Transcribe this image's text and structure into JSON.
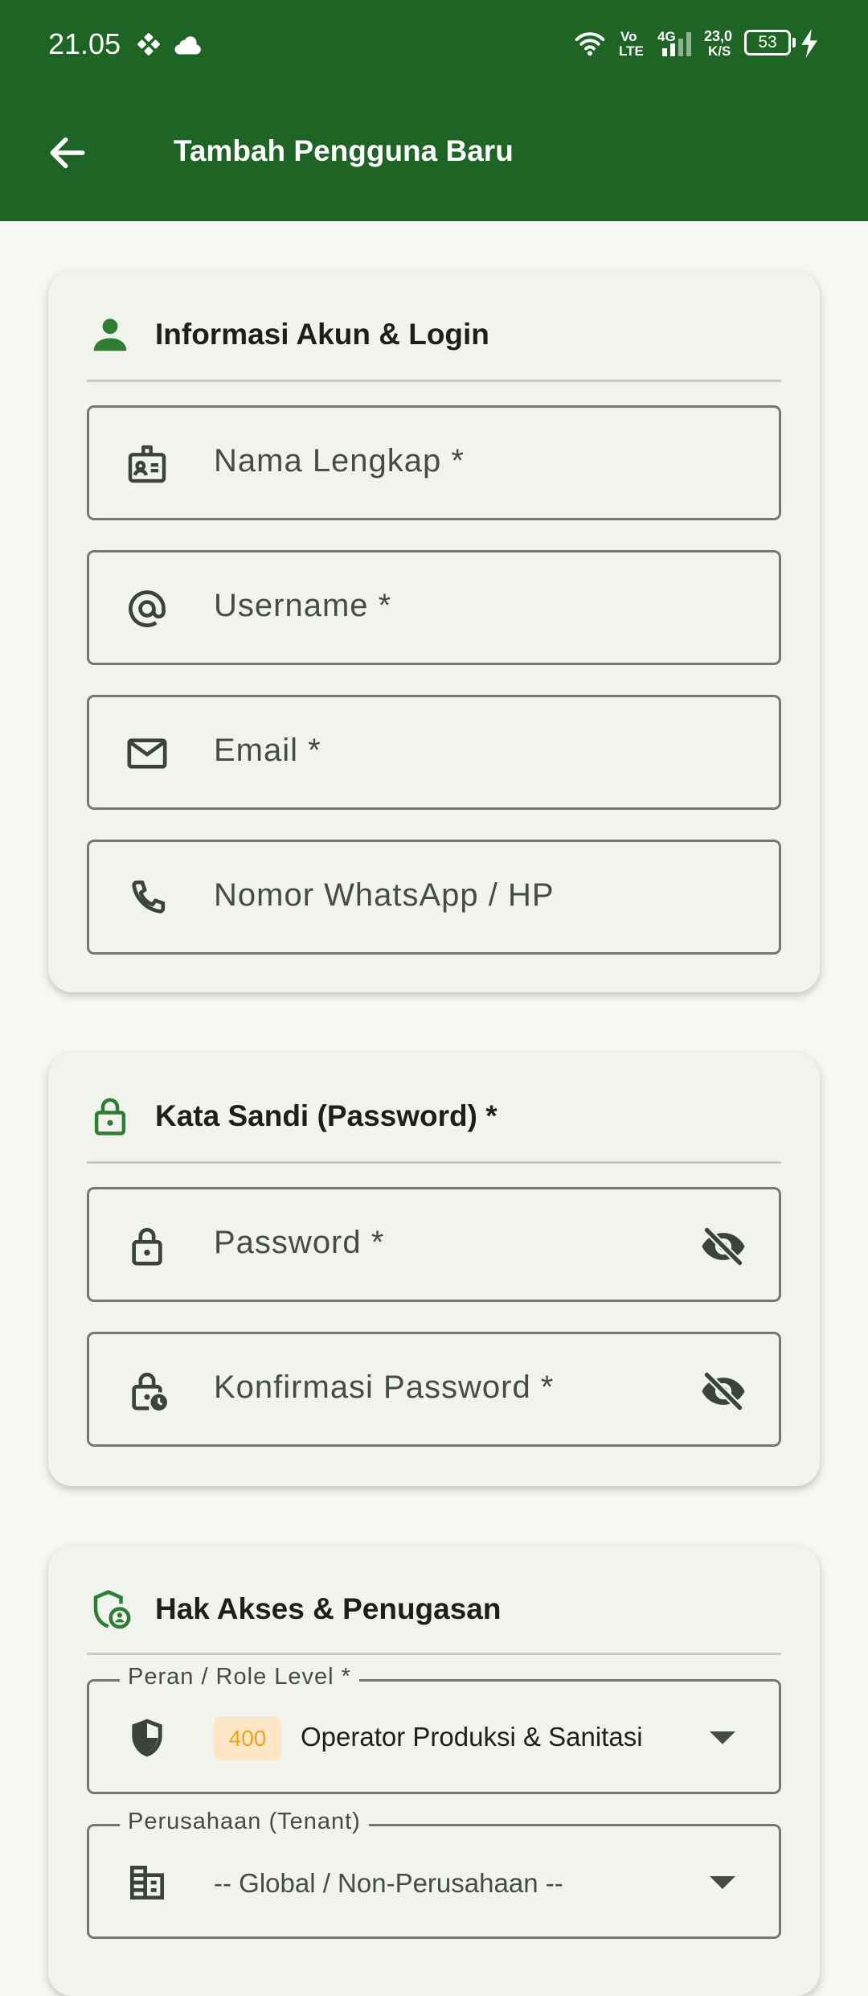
{
  "status_bar": {
    "time": "21.05",
    "network_vo": "Vo",
    "network_lte": "LTE",
    "network_4g": "4G",
    "speed_value": "23,0",
    "speed_unit": "K/S",
    "battery": "53"
  },
  "app_bar": {
    "title": "Tambah Pengguna Baru",
    "color": "#1e6424"
  },
  "sections": {
    "account": {
      "title": "Informasi Akun & Login",
      "fields": {
        "full_name": "Nama Lengkap *",
        "username": "Username *",
        "email": "Email *",
        "phone": "Nomor WhatsApp / HP"
      }
    },
    "password": {
      "title": "Kata Sandi (Password) *",
      "fields": {
        "password": "Password *",
        "confirm": "Konfirmasi Password *"
      }
    },
    "access": {
      "title": "Hak Akses & Penugasan",
      "role": {
        "label": "Peran / Role Level *",
        "badge": "400",
        "value": "Operator Produksi & Sanitasi"
      },
      "company": {
        "label": "Perusahaan (Tenant)",
        "value": "-- Global / Non-Perusahaan --"
      }
    }
  },
  "icons": {
    "back": "arrow-left-icon",
    "account_section": "person-icon",
    "name": "badge-icon",
    "username": "at-icon",
    "email": "mail-icon",
    "phone": "phone-icon",
    "password_section": "lock-icon",
    "password": "lock-icon",
    "confirm": "lock-clock-icon",
    "visibility": "eye-off-icon",
    "access_section": "shield-person-icon",
    "role": "shield-icon",
    "company": "building-icon",
    "dropdown": "caret-down-icon"
  },
  "colors": {
    "accent_green": "#2e7d32",
    "badge_bg": "#fde7c6",
    "badge_text": "#f0a21c"
  }
}
